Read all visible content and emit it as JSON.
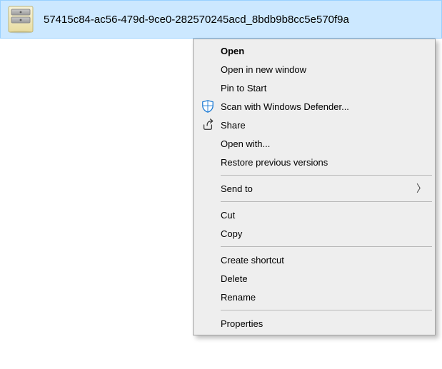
{
  "file": {
    "name": "57415c84-ac56-479d-9ce0-282570245acd_8bdb9b8cc5e570f9a"
  },
  "context_menu": {
    "open": "Open",
    "open_new_window": "Open in new window",
    "pin_to_start": "Pin to Start",
    "scan_defender": "Scan with Windows Defender...",
    "share": "Share",
    "open_with": "Open with...",
    "restore_previous": "Restore previous versions",
    "send_to": "Send to",
    "cut": "Cut",
    "copy": "Copy",
    "create_shortcut": "Create shortcut",
    "delete": "Delete",
    "rename": "Rename",
    "properties": "Properties"
  }
}
